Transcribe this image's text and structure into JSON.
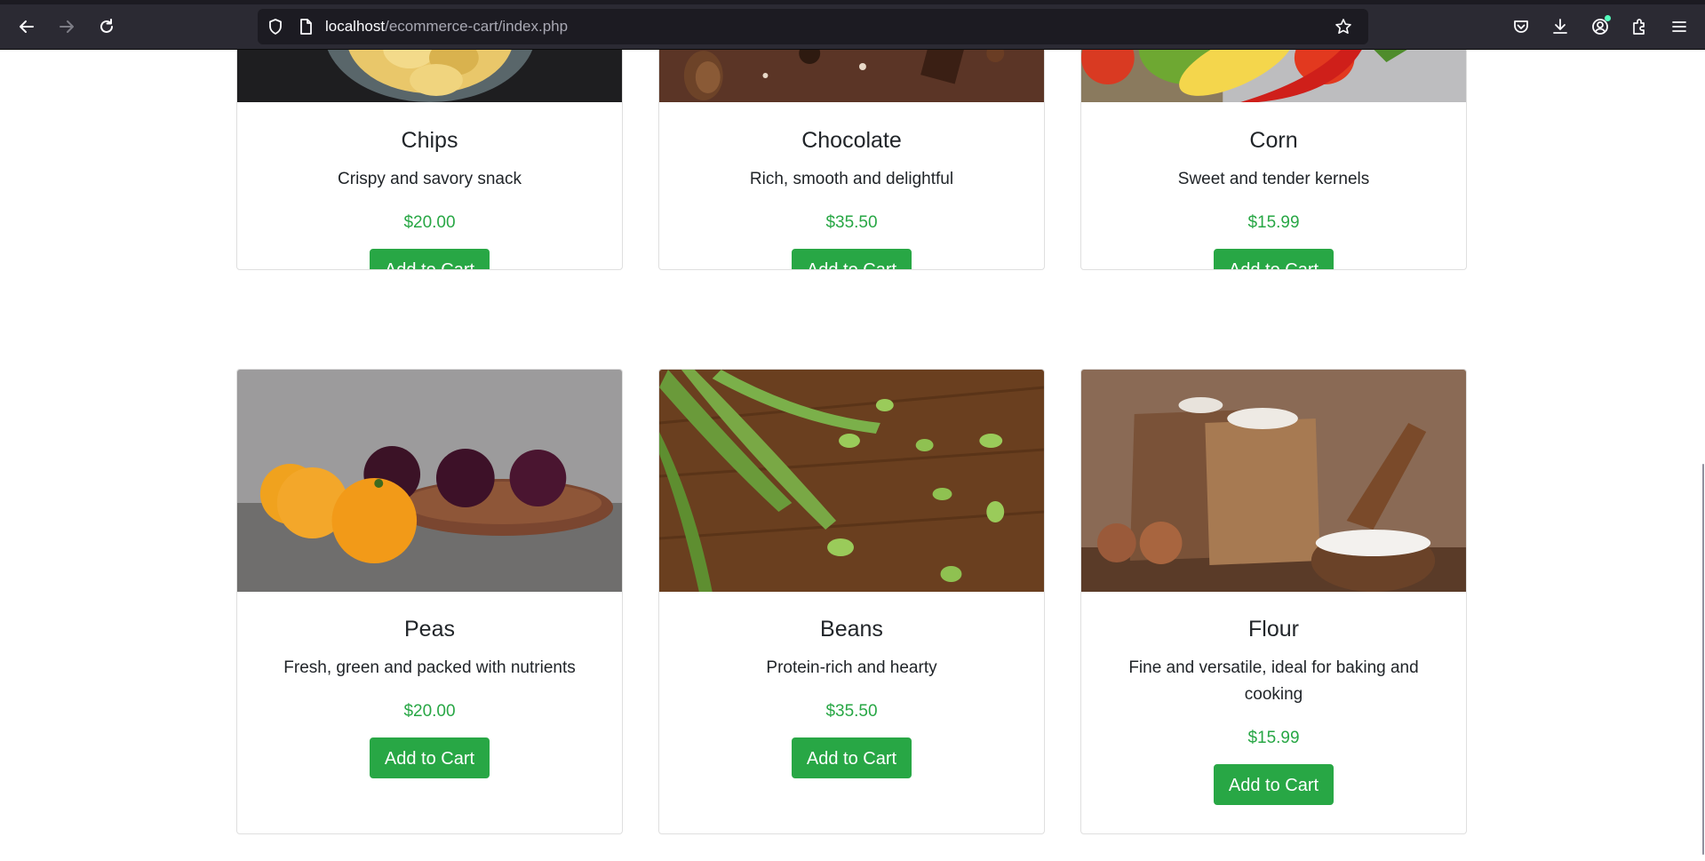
{
  "browser": {
    "url_host": "localhost",
    "url_path": "/ecommerce-cart/index.php",
    "icons": [
      "back-arrow-icon",
      "forward-arrow-icon",
      "reload-icon",
      "shield-icon",
      "page-icon",
      "bookmark-star-icon",
      "pocket-icon",
      "download-icon",
      "account-icon",
      "extensions-icon",
      "menu-icon"
    ]
  },
  "colors": {
    "accent_green": "#28a745",
    "chrome_bg": "#2b2a33",
    "urlbar_bg": "#1c1b22"
  },
  "products": [
    {
      "name": "Chips",
      "description": "Crispy and savory snack",
      "price": "$20.00",
      "button": "Add to Cart"
    },
    {
      "name": "Chocolate",
      "description": "Rich, smooth and delightful",
      "price": "$35.50",
      "button": "Add to Cart"
    },
    {
      "name": "Corn",
      "description": "Sweet and tender kernels",
      "price": "$15.99",
      "button": "Add to Cart"
    },
    {
      "name": "Peas",
      "description": "Fresh, green and packed with nutrients",
      "price": "$20.00",
      "button": "Add to Cart"
    },
    {
      "name": "Beans",
      "description": "Protein-rich and hearty",
      "price": "$35.50",
      "button": "Add to Cart"
    },
    {
      "name": "Flour",
      "description": "Fine and versatile, ideal for baking and cooking",
      "price": "$15.99",
      "button": "Add to Cart"
    }
  ]
}
